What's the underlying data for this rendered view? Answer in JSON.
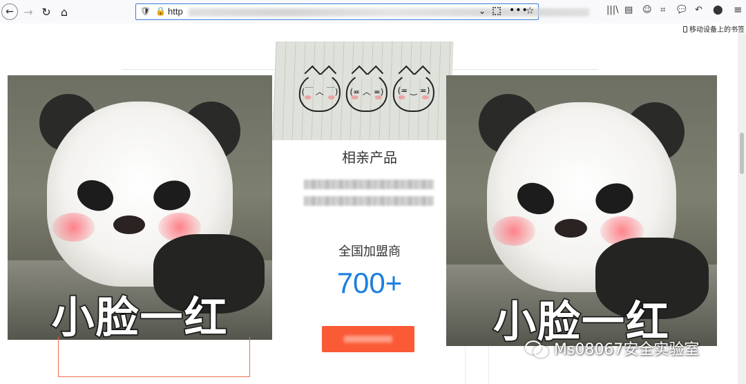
{
  "browser": {
    "url_prefix": "http",
    "icons": {
      "back": "←",
      "forward": "→",
      "reload": "↻",
      "home": "⌂",
      "shield": "🛡",
      "lock": "🔒",
      "dropdown": "⌄",
      "more": "•••",
      "star": "☆",
      "library": "|||\\",
      "sidebar": "▤",
      "account": "☺",
      "screenshot": "⌗",
      "chat": "💬",
      "undo": "↶",
      "extension": "⬤",
      "menu": "≡"
    },
    "bookmarks_label": "移动设备上的书签"
  },
  "page": {
    "product_title": "相亲产品",
    "franchise_label": "全国加盟商",
    "franchise_count": "700+",
    "meme_caption": "小脸一红",
    "note_faces": [
      "(￣ ︿ ￣)",
      "(≖ ︿ ≖)",
      "(≖ ‿ ≖)"
    ]
  },
  "watermark": {
    "text": "Ms08067安全实验室"
  },
  "colors": {
    "accent_blue": "#1a7fe0",
    "cta_orange": "#fa5a35",
    "frame_orange": "#f26b4c"
  }
}
